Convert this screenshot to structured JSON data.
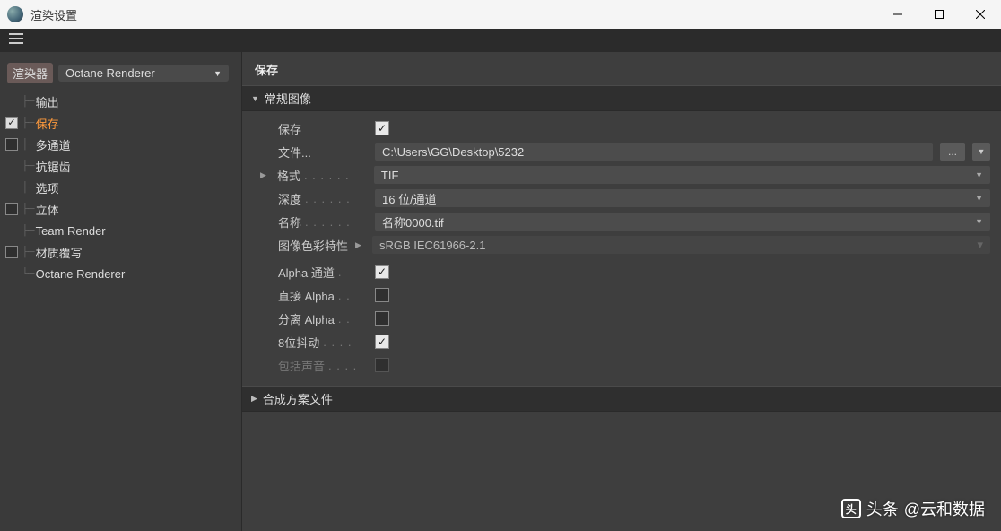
{
  "window": {
    "title": "渲染设置"
  },
  "sidebar": {
    "renderer_label": "渲染器",
    "renderer_value": "Octane Renderer",
    "items": [
      {
        "label": "输出",
        "checkbox": null,
        "active": false
      },
      {
        "label": "保存",
        "checkbox": true,
        "active": true
      },
      {
        "label": "多通道",
        "checkbox": false,
        "active": false
      },
      {
        "label": "抗锯齿",
        "checkbox": null,
        "active": false
      },
      {
        "label": "选项",
        "checkbox": null,
        "active": false
      },
      {
        "label": "立体",
        "checkbox": false,
        "active": false
      },
      {
        "label": "Team Render",
        "checkbox": null,
        "active": false
      },
      {
        "label": "材质覆写",
        "checkbox": false,
        "active": false
      },
      {
        "label": "Octane Renderer",
        "checkbox": null,
        "active": false
      }
    ]
  },
  "panel": {
    "title": "保存",
    "section1": {
      "header": "常规图像",
      "save_label": "保存",
      "save_checked": true,
      "file_label": "文件...",
      "file_value": "C:\\Users\\GG\\Desktop\\5232",
      "format_label": "格式",
      "format_value": "TIF",
      "depth_label": "深度",
      "depth_value": "16 位/通道",
      "name_label": "名称",
      "name_value": "名称0000.tif",
      "profile_label": "图像色彩特性",
      "profile_value": "sRGB IEC61966-2.1",
      "alpha_label": "Alpha 通道",
      "alpha_checked": true,
      "direct_alpha_label": "直接 Alpha",
      "direct_alpha_checked": false,
      "sep_alpha_label": "分离 Alpha",
      "sep_alpha_checked": false,
      "dither_label": "8位抖动",
      "dither_checked": true,
      "sound_label": "包括声音",
      "sound_checked": false
    },
    "section2": {
      "header": "合成方案文件"
    }
  },
  "watermark": {
    "prefix": "头条",
    "text": "@云和数据"
  }
}
